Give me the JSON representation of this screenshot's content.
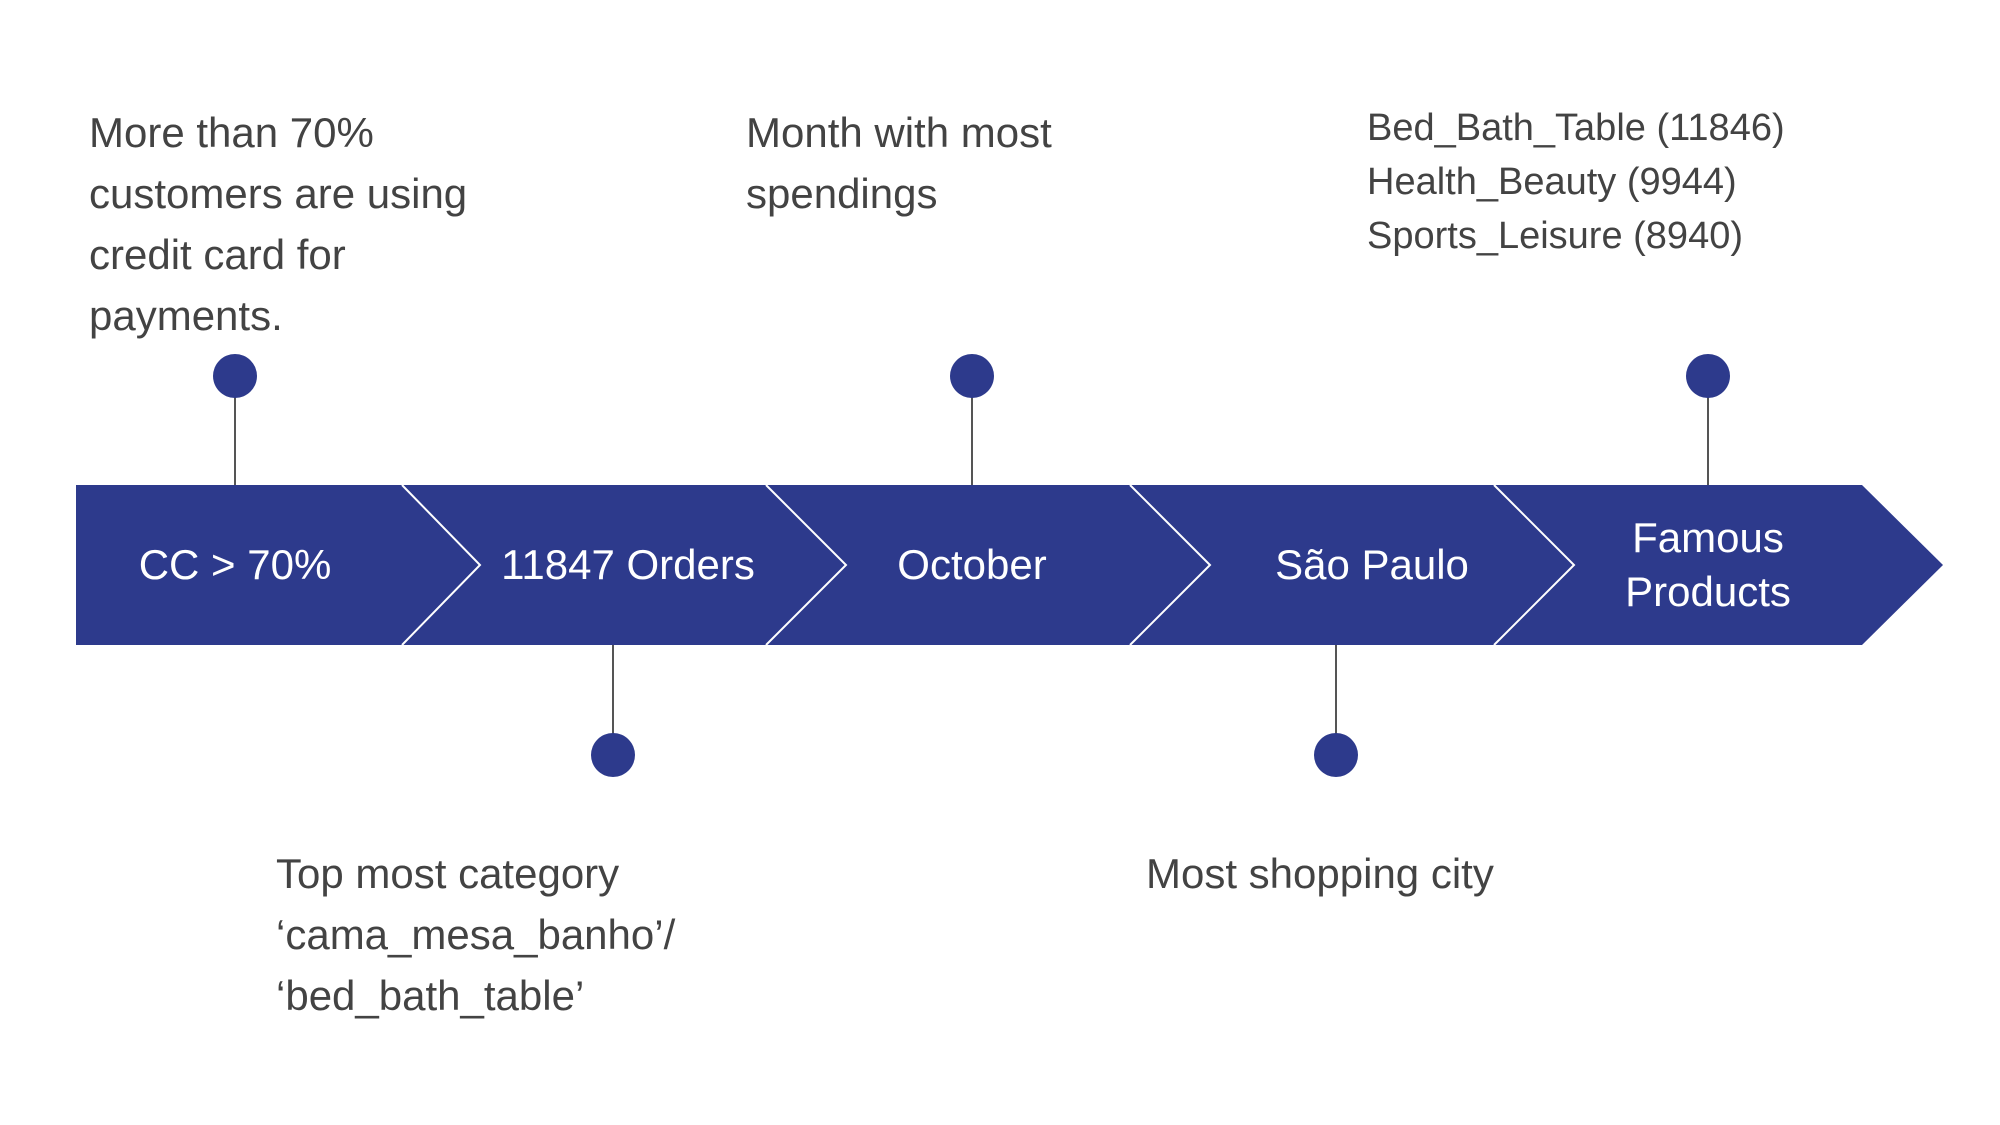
{
  "colors": {
    "arrow_fill": "#2d3a8c",
    "arrow_divider": "#ffffff",
    "dot": "#2d3a8c",
    "connector": "#555555",
    "text": "#434343",
    "label_text": "#ffffff"
  },
  "segments": [
    {
      "lines": [
        "CC > 70%"
      ]
    },
    {
      "lines": [
        "11847 Orders"
      ]
    },
    {
      "lines": [
        "October"
      ]
    },
    {
      "lines": [
        "São Paulo"
      ]
    },
    {
      "lines": [
        "Famous",
        "Products"
      ]
    }
  ],
  "annotations_top": [
    {
      "lines": [
        "More than 70%",
        "customers are using",
        "credit card for",
        "payments."
      ]
    },
    {
      "lines": [
        "Month with most",
        "spendings"
      ]
    },
    {
      "lines": [
        "Bed_Bath_Table (11846)",
        "Health_Beauty (9944)",
        "Sports_Leisure (8940)"
      ]
    }
  ],
  "annotations_bottom": [
    {
      "lines": [
        "Top most category",
        "‘cama_mesa_banho’/",
        "‘bed_bath_table’"
      ]
    },
    {
      "lines": [
        "Most shopping city"
      ]
    }
  ]
}
